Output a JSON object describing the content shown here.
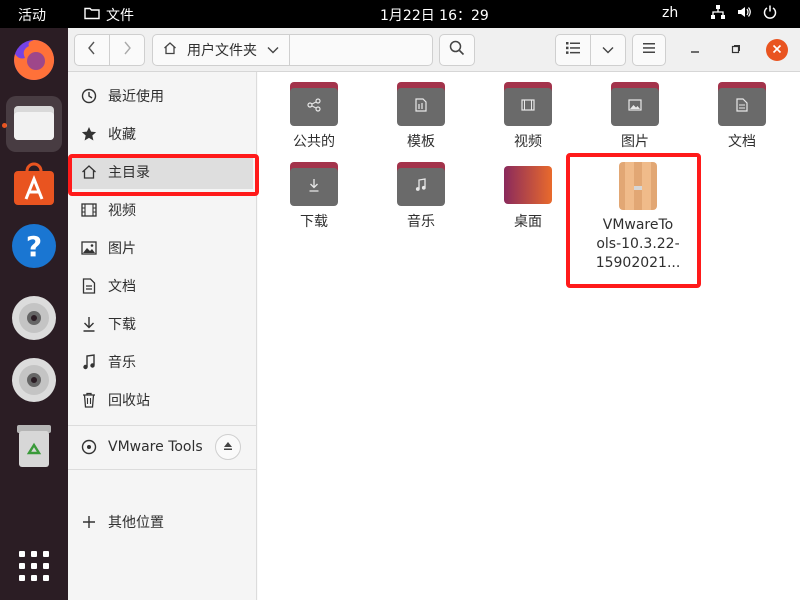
{
  "topbar": {
    "activities": "活动",
    "app_name": "文件",
    "clock": "1月22日  16：29",
    "ime": "zh"
  },
  "dock": {
    "items": [
      {
        "name": "firefox"
      },
      {
        "name": "files",
        "active": true
      },
      {
        "name": "software"
      },
      {
        "name": "help"
      },
      {
        "name": "disc-1"
      },
      {
        "name": "disc-2"
      },
      {
        "name": "trash"
      },
      {
        "name": "app-grid"
      }
    ]
  },
  "headerbar": {
    "path_label": "用户文件夹"
  },
  "sidebar": {
    "items": [
      {
        "label": "最近使用",
        "icon": "clock-icon"
      },
      {
        "label": "收藏",
        "icon": "star-icon"
      },
      {
        "label": "主目录",
        "icon": "home-icon",
        "selected": true
      },
      {
        "label": "视频",
        "icon": "video-icon"
      },
      {
        "label": "图片",
        "icon": "image-icon"
      },
      {
        "label": "文档",
        "icon": "document-icon"
      },
      {
        "label": "下载",
        "icon": "download-icon"
      },
      {
        "label": "音乐",
        "icon": "music-icon"
      },
      {
        "label": "回收站",
        "icon": "trash-icon"
      }
    ],
    "device": {
      "label": "VMware Tools"
    },
    "other": {
      "label": "其他位置"
    }
  },
  "content": {
    "items": [
      {
        "label": "公共的",
        "icon": "share-icon"
      },
      {
        "label": "模板",
        "icon": "template-icon"
      },
      {
        "label": "视频",
        "icon": "video-icon"
      },
      {
        "label": "图片",
        "icon": "image-icon"
      },
      {
        "label": "文档",
        "icon": "document-icon"
      },
      {
        "label": "下载",
        "icon": "download-icon"
      },
      {
        "label": "音乐",
        "icon": "music-icon"
      },
      {
        "label": "桌面",
        "icon": "desktop-icon"
      },
      {
        "label_lines": [
          "VMwareTo",
          "ols-10.3.22-",
          "15902021..."
        ],
        "icon": "archive-icon"
      }
    ]
  },
  "colors": {
    "accent": "#e95420",
    "folder_tab": "#a3334b",
    "folder_body": "#6a6a6a",
    "highlight": "#ff1a1a"
  }
}
